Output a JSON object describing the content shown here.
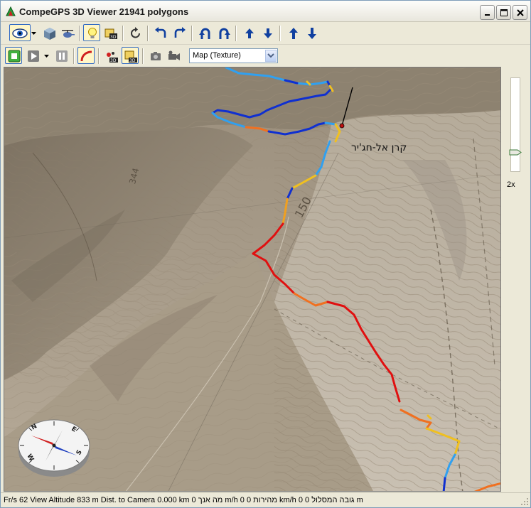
{
  "window": {
    "title": "CompeGPS 3D Viewer  21941 polygons"
  },
  "toolbar": {
    "map_mode": {
      "selected": "Map (Texture)"
    },
    "row1_icons": [
      "eye-icon",
      "cube-icon",
      "helicopter-icon",
      "bulb-icon",
      "map-3d-icon",
      "refresh-icon",
      "rotate-left-icon",
      "rotate-right-icon",
      "turn-up-left-icon",
      "turn-up-right-icon",
      "arrow-up-icon",
      "arrow-down-icon",
      "arrow-up-icon",
      "arrow-down-icon"
    ],
    "row2_icons": [
      "stop-icon",
      "play-icon",
      "pause-icon",
      "track-curve-icon",
      "biker-3d-icon",
      "map-3d-icon",
      "camera-icon",
      "video-camera-icon"
    ]
  },
  "viewport": {
    "place_label": "קרן אל-חג'יר",
    "contour_label": "150",
    "contour_label2": "344",
    "compass": {
      "north": "N",
      "east": "E",
      "south": "S",
      "west": "W"
    }
  },
  "side_panel": {
    "zoom_label": "2x",
    "zoom_level_fraction": 0.1
  },
  "statusbar": {
    "text": "Fr/s 62 View Altitude 833 m Dist. to Camera 0.000 km 0 מה אנך m/h 0 מהירות 0 km/h 0 גובה המסלול 0 m"
  },
  "colors": {
    "track_blue": "#1030d0",
    "track_cyan": "#30a0f0",
    "track_yellow": "#f0c020",
    "track_orange": "#f07020",
    "track_red": "#e01010"
  }
}
